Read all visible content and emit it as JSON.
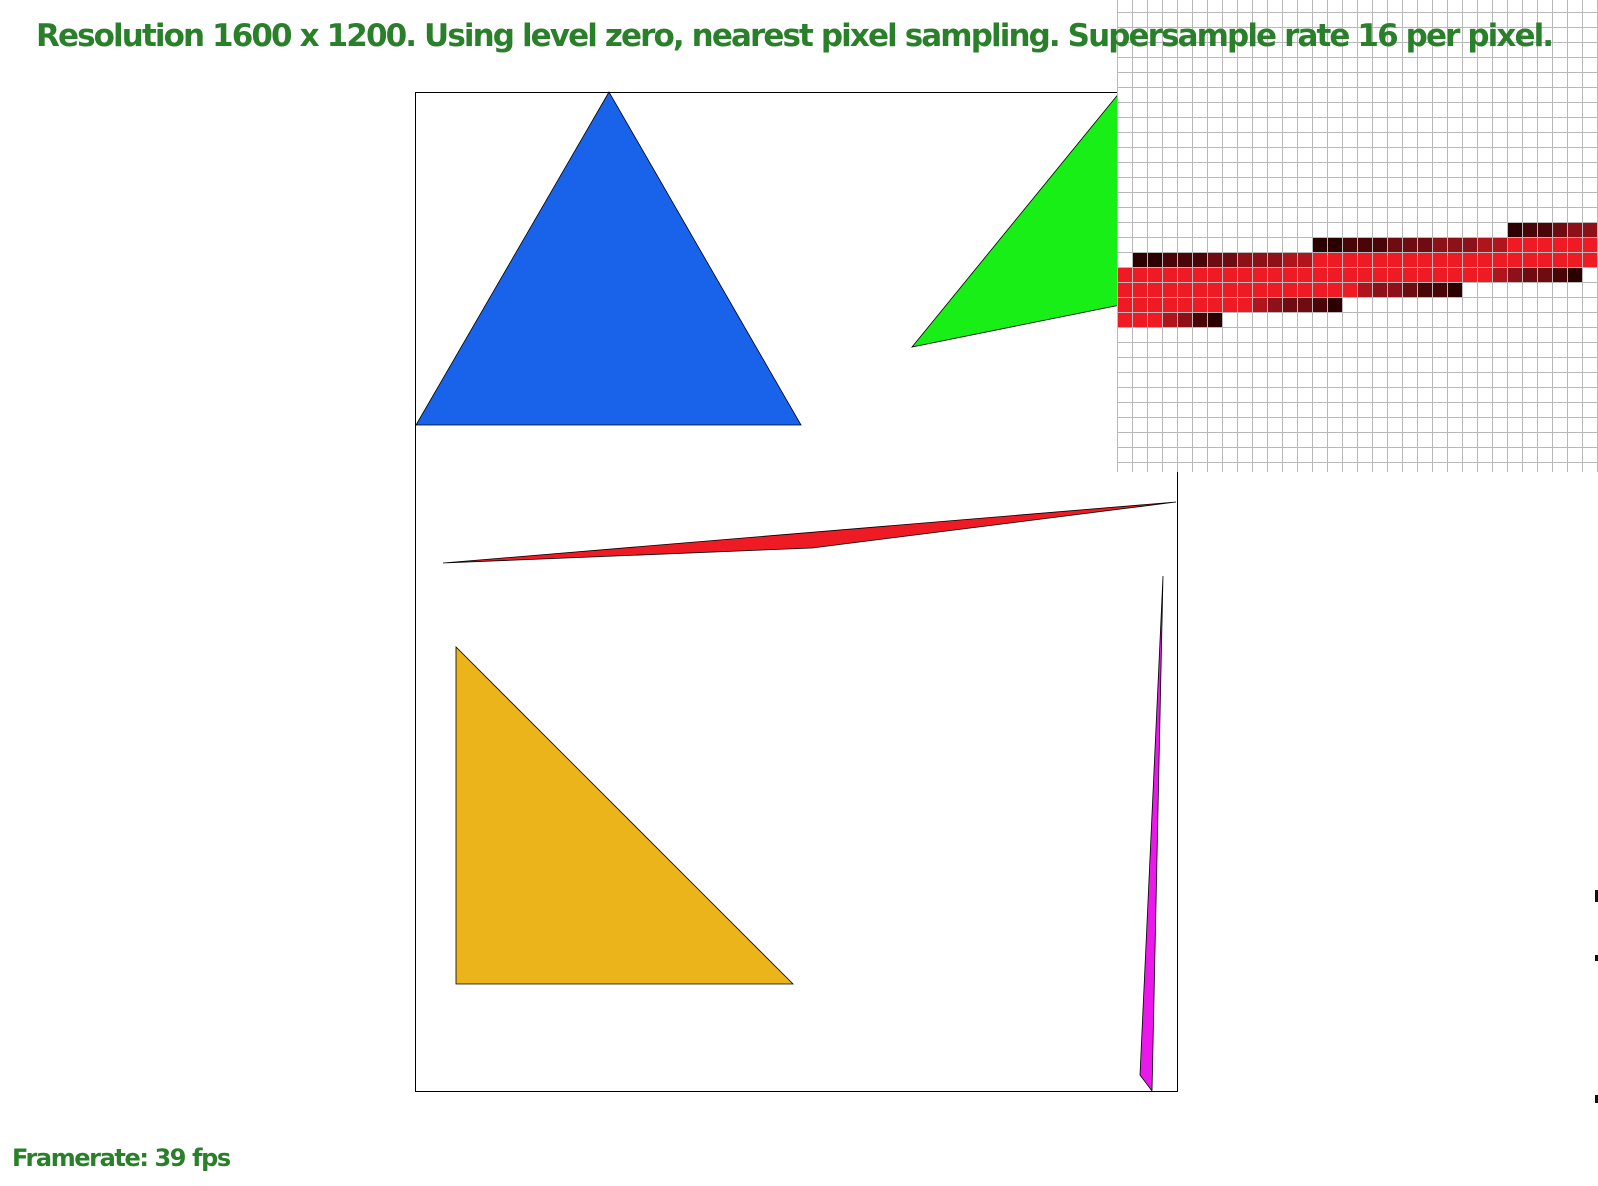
{
  "hud": {
    "title": "Resolution 1600 x 1200. Using level zero, nearest pixel sampling. Supersample rate 16 per pixel.",
    "framerate": "Framerate: 39 fps"
  },
  "colors": {
    "hud_text": "#2a7f2a",
    "blue_triangle": "#1963eb",
    "green_triangle": "#17ef17",
    "red_triangle": "#ee1a24",
    "yellow_triangle": "#ebb41a",
    "magenta_triangle": "#ea18ea",
    "grid_line": "#b8b8b8"
  }
}
